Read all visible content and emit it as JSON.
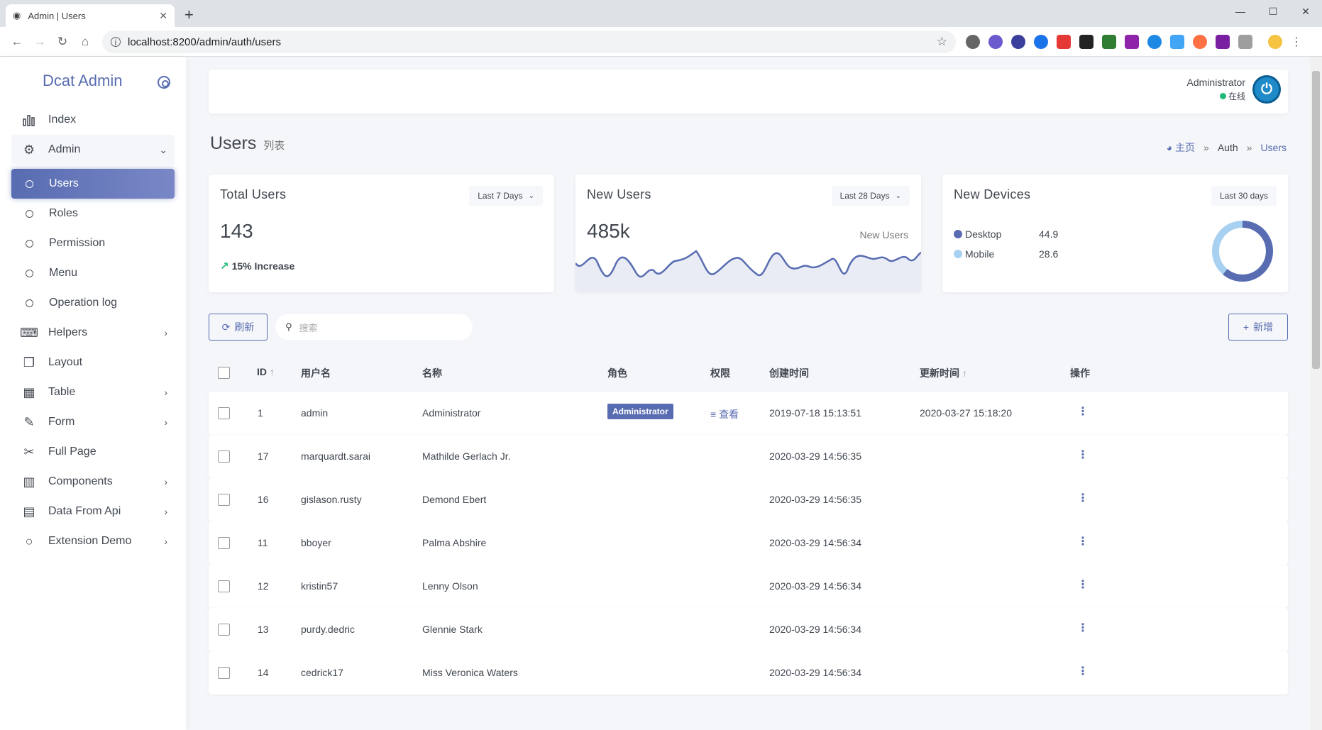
{
  "browser": {
    "tab_title": "Admin | Users",
    "tab_close": "✕",
    "new_tab": "+",
    "url": "localhost:8200/admin/auth/users",
    "minimize": "—",
    "maximize": "☐",
    "close": "✕"
  },
  "sidebar": {
    "brand": "Dcat Admin",
    "items": [
      {
        "label": "Index",
        "icon": "bar-chart-icon"
      },
      {
        "label": "Admin",
        "icon": "gear-icon"
      },
      {
        "label": "Helpers",
        "icon": "keyboard-icon"
      },
      {
        "label": "Layout",
        "icon": "cubes-icon"
      },
      {
        "label": "Table",
        "icon": "grid-icon"
      },
      {
        "label": "Form",
        "icon": "edit-icon"
      },
      {
        "label": "Full Page",
        "icon": "scissors-icon"
      },
      {
        "label": "Components",
        "icon": "building-icon"
      },
      {
        "label": "Data From Api",
        "icon": "film-icon"
      },
      {
        "label": "Extension Demo",
        "icon": "circle-icon"
      }
    ],
    "admin_sub": [
      "Users",
      "Roles",
      "Permission",
      "Menu",
      "Operation log"
    ]
  },
  "user": {
    "name": "Administrator",
    "status": "在线"
  },
  "page": {
    "title": "Users",
    "subtitle": "列表",
    "breadcrumb": [
      "主页",
      "Auth",
      "Users"
    ]
  },
  "cards": {
    "total": {
      "title": "Total Users",
      "range": "Last 7 Days",
      "value": "143",
      "trend": "15% Increase"
    },
    "new": {
      "title": "New Users",
      "range": "Last 28 Days",
      "value": "485k",
      "aside": "New Users"
    },
    "devices": {
      "title": "New Devices",
      "range": "Last 30 days",
      "legend": [
        {
          "name": "Desktop",
          "value": "44.9",
          "color": "#586cb1"
        },
        {
          "name": "Mobile",
          "value": "28.6",
          "color": "#a8d1f1"
        }
      ]
    }
  },
  "toolbar": {
    "refresh": "刷新",
    "search_placeholder": "搜索",
    "add": "新增"
  },
  "table": {
    "headers": {
      "id": "ID",
      "username": "用户名",
      "name": "名称",
      "roles": "角色",
      "permissions": "权限",
      "created": "创建时间",
      "updated": "更新时间",
      "actions": "操作"
    },
    "rows": [
      {
        "id": "1",
        "username": "admin",
        "name": "Administrator",
        "role": "Administrator",
        "perm": "查看",
        "created": "2019-07-18 15:13:51",
        "updated": "2020-03-27 15:18:20"
      },
      {
        "id": "17",
        "username": "marquardt.sarai",
        "name": "Mathilde Gerlach Jr.",
        "role": "",
        "perm": "",
        "created": "2020-03-29 14:56:35",
        "updated": ""
      },
      {
        "id": "16",
        "username": "gislason.rusty",
        "name": "Demond Ebert",
        "role": "",
        "perm": "",
        "created": "2020-03-29 14:56:35",
        "updated": ""
      },
      {
        "id": "11",
        "username": "bboyer",
        "name": "Palma Abshire",
        "role": "",
        "perm": "",
        "created": "2020-03-29 14:56:34",
        "updated": ""
      },
      {
        "id": "12",
        "username": "kristin57",
        "name": "Lenny Olson",
        "role": "",
        "perm": "",
        "created": "2020-03-29 14:56:34",
        "updated": ""
      },
      {
        "id": "13",
        "username": "purdy.dedric",
        "name": "Glennie Stark",
        "role": "",
        "perm": "",
        "created": "2020-03-29 14:56:34",
        "updated": ""
      },
      {
        "id": "14",
        "username": "cedrick17",
        "name": "Miss Veronica Waters",
        "role": "",
        "perm": "",
        "created": "2020-03-29 14:56:34",
        "updated": ""
      }
    ]
  }
}
